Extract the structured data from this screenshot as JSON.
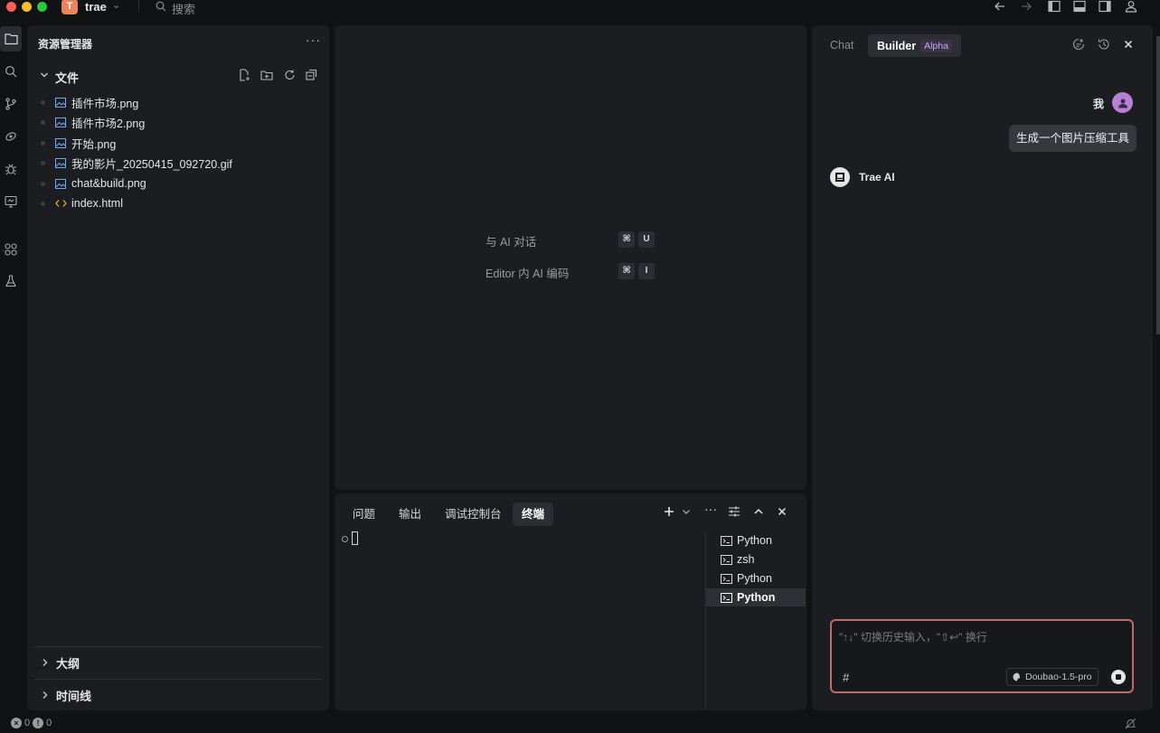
{
  "titlebar": {
    "project_initial": "T",
    "project_name": "trae",
    "search_placeholder": "搜索"
  },
  "explorer": {
    "title": "资源管理器",
    "more": "···",
    "files_section": "文件",
    "files": [
      {
        "name": "插件市场.png",
        "type": "image"
      },
      {
        "name": "插件市场2.png",
        "type": "image"
      },
      {
        "name": "开始.png",
        "type": "image"
      },
      {
        "name": "我的影片_20250415_092720.gif",
        "type": "image"
      },
      {
        "name": "chat&build.png",
        "type": "image"
      },
      {
        "name": "index.html",
        "type": "code"
      }
    ],
    "outline_section": "大纲",
    "timeline_section": "时间线"
  },
  "editor": {
    "hints": [
      {
        "label": "与 AI 对话",
        "keys": [
          "⌘",
          "U"
        ]
      },
      {
        "label": "Editor 内 AI 编码",
        "keys": [
          "⌘",
          "I"
        ]
      }
    ]
  },
  "panel": {
    "tabs": [
      "问题",
      "输出",
      "调试控制台",
      "终端"
    ],
    "active_tab": "终端",
    "terminals": [
      {
        "name": "Python",
        "active": false
      },
      {
        "name": "zsh",
        "active": false
      },
      {
        "name": "Python",
        "active": false
      },
      {
        "name": "Python",
        "active": true
      }
    ]
  },
  "chat": {
    "tabs": {
      "chat": "Chat",
      "builder": "Builder",
      "builder_badge": "Alpha"
    },
    "user_label": "我",
    "user_message": "生成一个图片压缩工具",
    "ai_name": "Trae AI",
    "input_placeholder": "\"↑↓\" 切换历史输入，\"⇧↩\" 换行",
    "hash": "#",
    "model": "Doubao-1.5-pro"
  },
  "statusbar": {
    "errors": "0",
    "warnings": "0"
  },
  "colors": {
    "accent_input_border": "#c26a6a",
    "avatar_user": "#b780d4",
    "project_badge": "#e8855f",
    "alpha_badge": "#c9a4e9"
  }
}
